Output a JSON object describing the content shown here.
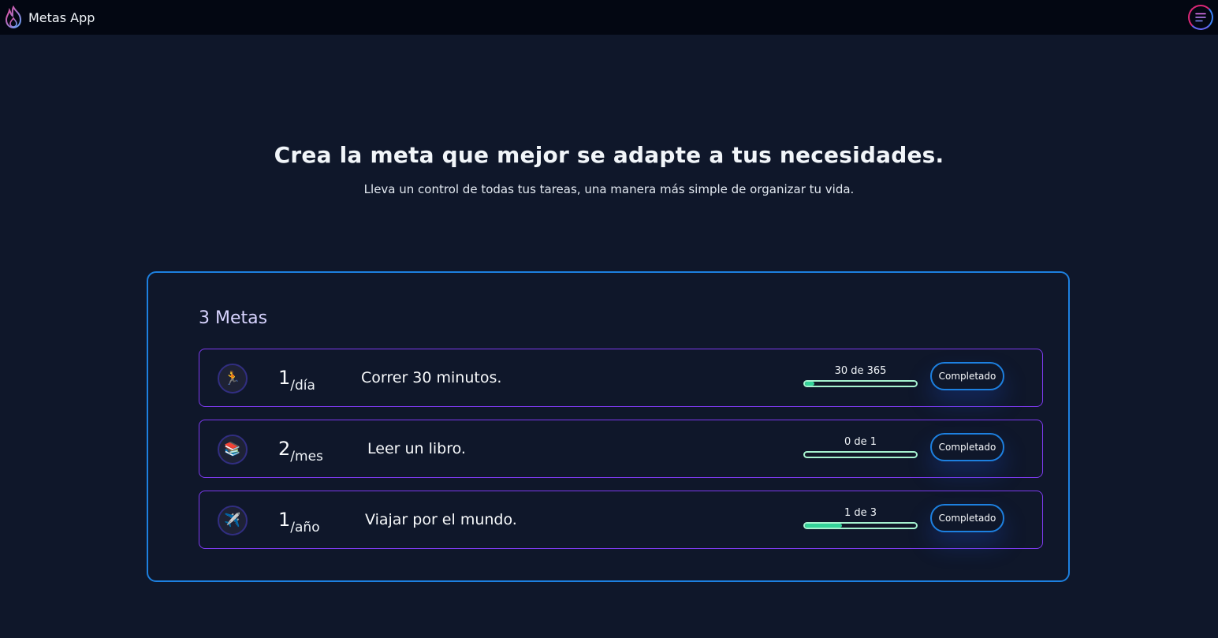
{
  "app": {
    "name": "Metas App"
  },
  "header": {
    "logo_icon": "flame-logo-icon",
    "menu_icon": "hamburger-menu-icon"
  },
  "hero": {
    "title": "Crea la meta que mejor se adapte a tus necesidades.",
    "subtitle": "Lleva un control de todas tus tareas, una manera más simple de organizar tu vida."
  },
  "goals_panel": {
    "count_label": "3 Metas",
    "goals": [
      {
        "icon": "🏃",
        "icon_name": "running-icon",
        "frequency_count": "1",
        "frequency_period": "/día",
        "title": "Correr 30 minutos.",
        "progress_label": "30 de 365",
        "progress_fraction": 0.082,
        "button_label": "Completado"
      },
      {
        "icon": "📚",
        "icon_name": "books-icon",
        "frequency_count": "2",
        "frequency_period": "/mes",
        "title": "Leer un libro.",
        "progress_label": "0 de 1",
        "progress_fraction": 0,
        "button_label": "Completado"
      },
      {
        "icon": "✈️",
        "icon_name": "airplane-icon",
        "frequency_count": "1",
        "frequency_period": "/año",
        "title": "Viajar por el mundo.",
        "progress_label": "1 de 3",
        "progress_fraction": 0.333,
        "button_label": "Completado"
      }
    ]
  },
  "colors": {
    "background": "#0f172a",
    "topbar": "#030712",
    "card_border": "#1d80e0",
    "goal_border": "#7c3aed",
    "progress_fill": "#34d399"
  }
}
